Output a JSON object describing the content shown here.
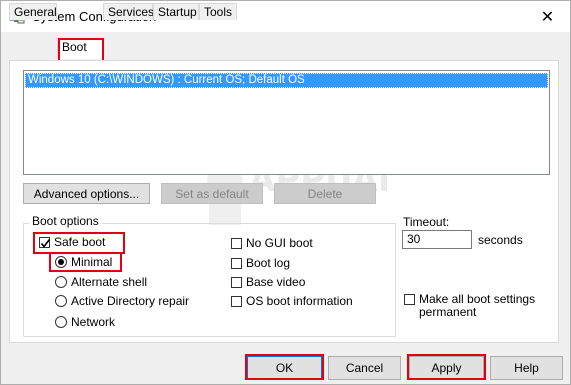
{
  "window": {
    "title": "System Configuration",
    "app_icon": "msconfig-icon",
    "close_icon": "close-icon",
    "close_glyph": "✕"
  },
  "tabs": [
    {
      "label": "General",
      "active": false
    },
    {
      "label": "Boot",
      "active": true
    },
    {
      "label": "Services",
      "active": false
    },
    {
      "label": "Startup",
      "active": false
    },
    {
      "label": "Tools",
      "active": false
    }
  ],
  "os_list": {
    "items": [
      "Windows 10 (C:\\WINDOWS) : Current OS; Default OS"
    ]
  },
  "list_buttons": {
    "advanced": "Advanced options...",
    "set_default": "Set as default",
    "delete": "Delete"
  },
  "boot_options": {
    "legend": "Boot options",
    "safe_boot": {
      "label": "Safe boot",
      "checked": true
    },
    "minimal": {
      "label": "Minimal",
      "selected": true
    },
    "alternate_shell": {
      "label": "Alternate shell",
      "selected": false
    },
    "active_directory_repair": {
      "label": "Active Directory repair",
      "selected": false
    },
    "network": {
      "label": "Network",
      "selected": false
    },
    "no_gui_boot": {
      "label": "No GUI boot",
      "checked": false
    },
    "boot_log": {
      "label": "Boot log",
      "checked": false
    },
    "base_video": {
      "label": "Base video",
      "checked": false
    },
    "os_boot_information": {
      "label": "OS boot information",
      "checked": false
    }
  },
  "timeout": {
    "label": "Timeout:",
    "value": "30",
    "unit": "seconds"
  },
  "make_permanent": {
    "line1": "Make all boot settings",
    "line2": "permanent",
    "checked": false
  },
  "footer_buttons": {
    "ok": "OK",
    "cancel": "Cancel",
    "apply": "Apply",
    "help": "Help"
  },
  "highlight_color": "#e30012",
  "selection_color": "#3399ff"
}
